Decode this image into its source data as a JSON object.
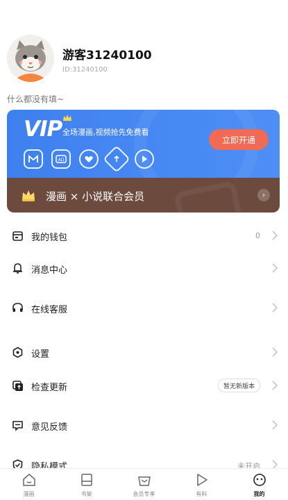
{
  "profile": {
    "username": "游客31240100",
    "user_id": "ID:31240100",
    "bio": "什么都没有填~"
  },
  "vip": {
    "logo": "VIP",
    "slogan": "全场漫画,视频抢先免费看",
    "open_button": "立即开通",
    "perk_icons": [
      "m-badge-icon",
      "ad-free-icon",
      "heart-icon",
      "upload-icon",
      "play-icon"
    ],
    "union_label": "漫画 × 小说联合会员",
    "colors": {
      "blue": "#4d8ff5",
      "brown": "#6c4a3d",
      "button": "#f06a55"
    }
  },
  "menu": {
    "wallet": {
      "label": "我的钱包",
      "value": "0",
      "icon": "wallet-icon"
    },
    "messages": {
      "label": "消息中心",
      "icon": "bell-icon"
    },
    "support": {
      "label": "在线客服",
      "icon": "headset-icon"
    },
    "settings": {
      "label": "设置",
      "icon": "settings-icon"
    },
    "update": {
      "label": "检查更新",
      "badge": "暂无新版本",
      "icon": "update-icon"
    },
    "feedback": {
      "label": "意见反馈",
      "icon": "feedback-icon"
    },
    "privacy": {
      "label": "隐私模式",
      "value": "未开启",
      "icon": "privacy-icon"
    }
  },
  "nav": {
    "comics": "漫画",
    "bookshelf": "书架",
    "vip": "会员专享",
    "interesting": "有料",
    "mine": "我的",
    "active": "mine"
  }
}
